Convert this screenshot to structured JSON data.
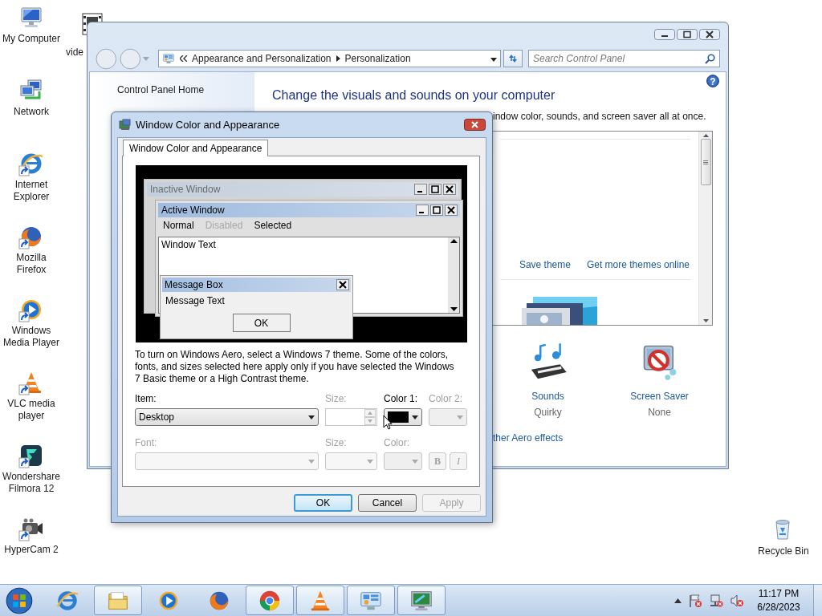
{
  "desktop_icons": [
    {
      "label": "My Computer",
      "kind": "computer",
      "shortcut": false
    },
    {
      "label": "Network",
      "kind": "network",
      "shortcut": false
    },
    {
      "label": "Internet Explorer",
      "kind": "ie",
      "shortcut": true
    },
    {
      "label": "Mozilla Firefox",
      "kind": "firefox",
      "shortcut": true
    },
    {
      "label": "Windows Media Player",
      "kind": "wmp",
      "shortcut": true
    },
    {
      "label": "VLC media player",
      "kind": "vlc",
      "shortcut": true
    },
    {
      "label": "Wondershare Filmora 12",
      "kind": "filmora",
      "shortcut": true
    },
    {
      "label": "HyperCam 2",
      "kind": "hypercam",
      "shortcut": true
    }
  ],
  "partial_icon": {
    "label": "vide",
    "kind": "video"
  },
  "recycle_bin": {
    "label": "Recycle Bin",
    "kind": "recycle"
  },
  "control_panel": {
    "address": [
      "Appearance and Personalization",
      "Personalization"
    ],
    "search": {
      "placeholder": "Search Control Panel"
    },
    "help": "?",
    "nav_link": "Control Panel Home",
    "heading": "Change the visuals and sounds on your computer",
    "intro": "indow color, sounds, and screen saver all at once.",
    "theme_links": [
      "Save theme",
      "Get more themes online"
    ],
    "settings": [
      {
        "label": "Sounds",
        "value": "Quirky",
        "kind": "sounds"
      },
      {
        "label": "Screen Saver",
        "value": "None",
        "kind": "screensaver"
      }
    ],
    "aero_link": "ther Aero effects"
  },
  "dialog": {
    "title": "Window Color and Appearance",
    "tabs": [
      {
        "label": "Window Color and Appearance",
        "selected": true
      }
    ],
    "preview": {
      "inactive_title": "Inactive Window",
      "active_title": "Active Window",
      "menu": [
        {
          "label": "Normal",
          "disabled": false
        },
        {
          "label": "Disabled",
          "disabled": true
        },
        {
          "label": "Selected",
          "disabled": false
        }
      ],
      "window_text": "Window Text",
      "message_title": "Message Box",
      "message_text": "Message Text",
      "message_button": "OK"
    },
    "note": "To turn on Windows Aero, select a Windows 7 theme.  Some of the colors, fonts, and sizes selected here apply only if you have selected the Windows 7 Basic theme or a High Contrast theme.",
    "item_fields": [
      {
        "label": "Item:",
        "kind": "combo",
        "value": "Desktop",
        "disabled": false
      },
      {
        "label": "Size:",
        "kind": "spin",
        "disabled": true
      },
      {
        "label": "Color 1:",
        "kind": "color",
        "color": "#000000",
        "disabled": false
      },
      {
        "label": "Color 2:",
        "kind": "color",
        "disabled": true
      }
    ],
    "font_fields": [
      {
        "label": "Font:",
        "kind": "combo",
        "disabled": true
      },
      {
        "label": "Size:",
        "kind": "combo",
        "disabled": true
      },
      {
        "label": "Color:",
        "kind": "color",
        "disabled": true
      }
    ],
    "style_buttons": [
      {
        "label": "B",
        "kind": "bold",
        "disabled": true
      },
      {
        "label": "I",
        "kind": "italic",
        "disabled": true
      }
    ],
    "buttons": [
      {
        "label": "OK",
        "default": true,
        "disabled": false
      },
      {
        "label": "Cancel",
        "default": false,
        "disabled": false
      },
      {
        "label": "Apply",
        "default": false,
        "disabled": true
      }
    ]
  },
  "taskbar": {
    "items": [
      {
        "kind": "ie",
        "running": false
      },
      {
        "kind": "explorer",
        "running": true
      },
      {
        "kind": "wmp",
        "running": false
      },
      {
        "kind": "firefox",
        "running": false
      },
      {
        "kind": "chrome",
        "running": true
      },
      {
        "kind": "vlc",
        "running": true
      },
      {
        "kind": "controlpanel",
        "running": true
      },
      {
        "kind": "display",
        "running": true
      }
    ],
    "clock": {
      "time": "11:17 PM",
      "date": "6/28/2023"
    }
  }
}
